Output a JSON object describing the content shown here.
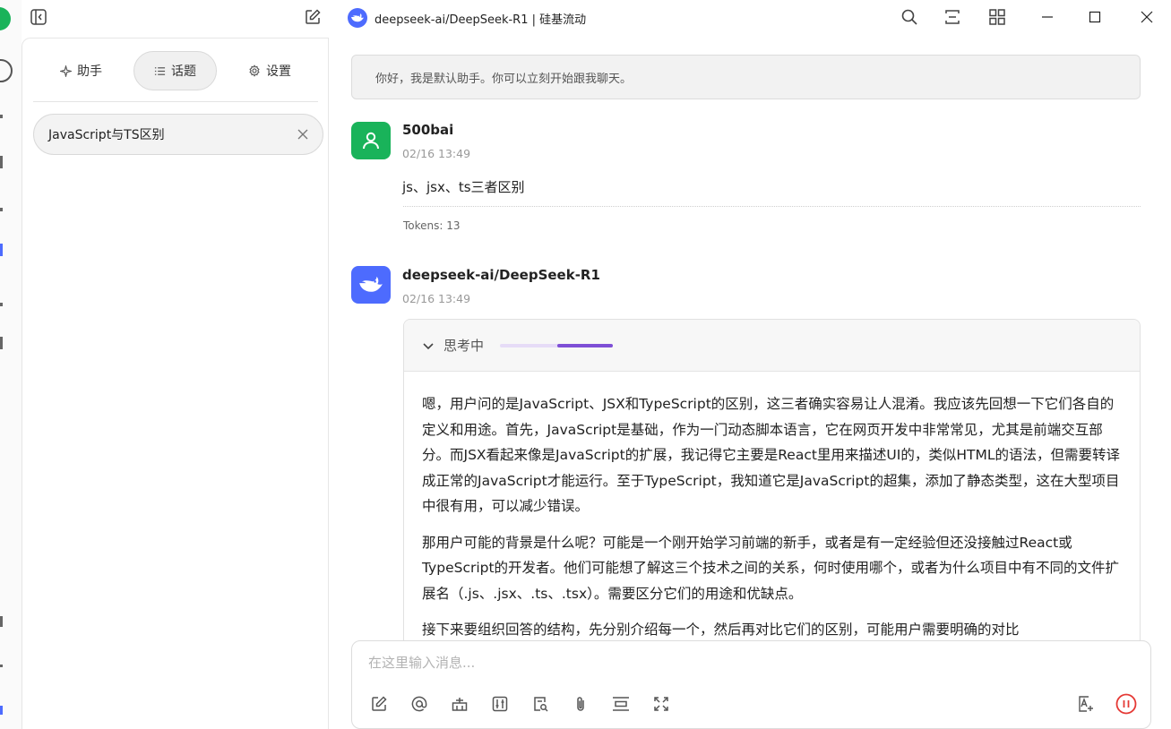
{
  "window": {
    "title": "deepseek-ai/DeepSeek-R1 | 硅基流动"
  },
  "sidebar": {
    "tabs": [
      {
        "label": "助手",
        "icon": "sparkle-icon"
      },
      {
        "label": "话题",
        "icon": "list-icon",
        "active": true
      },
      {
        "label": "设置",
        "icon": "gear-icon"
      }
    ],
    "topics": [
      {
        "label": "JavaScript与TS区别"
      }
    ]
  },
  "chat": {
    "notice": "你好，我是默认助手。你可以立刻开始跟我聊天。",
    "messages": [
      {
        "name": "500bai",
        "time": "02/16 13:49",
        "text": "js、jsx、ts三者区别",
        "tokens": "Tokens: 13"
      },
      {
        "name": "deepseek-ai/DeepSeek-R1",
        "time": "02/16 13:49",
        "thinking_label": "思考中",
        "paragraphs": [
          "嗯，用户问的是JavaScript、JSX和TypeScript的区别，这三者确实容易让人混淆。我应该先回想一下它们各自的定义和用途。首先，JavaScript是基础，作为一门动态脚本语言，它在网页开发中非常常见，尤其是前端交互部分。而JSX看起来像是JavaScript的扩展，我记得它主要是React里用来描述UI的，类似HTML的语法，但需要转译成正常的JavaScript才能运行。至于TypeScript，我知道它是JavaScript的超集，添加了静态类型，这在大型项目中很有用，可以减少错误。",
          "那用户可能的背景是什么呢？可能是一个刚开始学习前端的新手，或者是有一定经验但还没接触过React或TypeScript的开发者。他们可能想了解这三个技术之间的关系，何时使用哪个，或者为什么项目中有不同的文件扩展名（.js、.jsx、.ts、.tsx）。需要区分它们的用途和优缺点。",
          "接下来要组织回答的结构，先分别介绍每一个，然后再对比它们的区别，可能用户需要明确的对比"
        ]
      }
    ]
  },
  "input": {
    "placeholder": "在这里输入消息..."
  },
  "colors": {
    "user_avatar": "#19b35a",
    "deepseek_brand": "#4d6bfe",
    "thinking_bar": "#7e4fd6",
    "stop_button": "#e53935"
  }
}
